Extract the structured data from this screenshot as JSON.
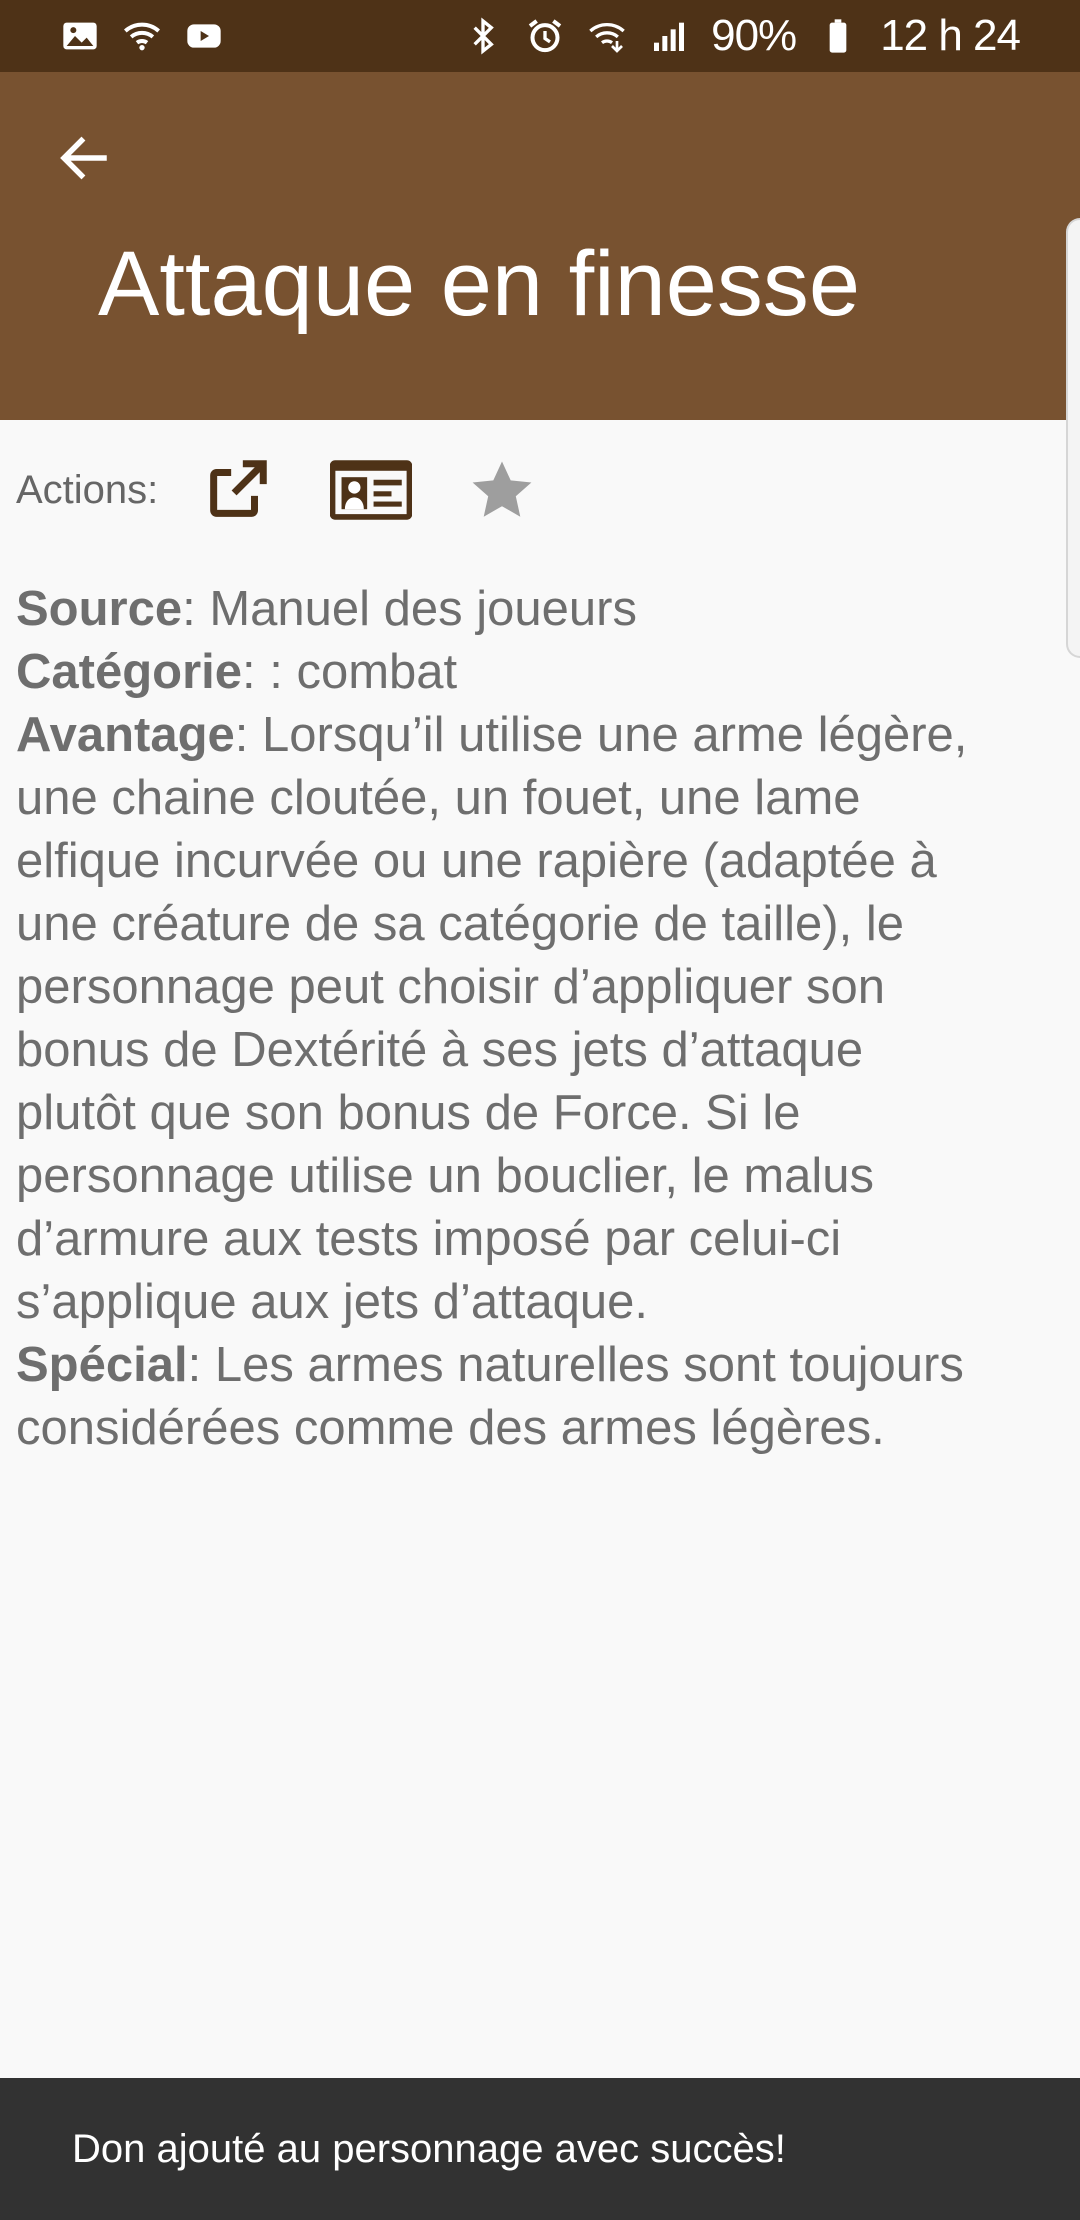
{
  "status_bar": {
    "left_icons": [
      "image-icon",
      "wifi-icon",
      "youtube-icon"
    ],
    "right_icons": [
      "bluetooth-icon",
      "alarm-icon",
      "wifi-calling-icon",
      "signal-icon"
    ],
    "battery": "90%",
    "time": "12 h 24"
  },
  "app_bar": {
    "title": "Attaque en finesse",
    "back_icon": "arrow-back-icon",
    "color": "#785230"
  },
  "actions": {
    "label": "Actions:",
    "icons": [
      "open-external-icon",
      "character-card-icon",
      "star-icon"
    ]
  },
  "feat": {
    "source_label": "Source",
    "source_value": ": Manuel des joueurs",
    "category_label": "Catégorie",
    "category_value": ": : combat",
    "benefit_label": "Avantage",
    "benefit_lines": [
      ": Lorsqu’il utilise une arme légère,",
      "une chaine cloutée, un fouet, une lame",
      "elfique incurvée ou une rapière (adaptée à",
      "une créature de sa catégorie de taille), le",
      "personnage peut choisir d’appliquer son",
      "bonus de Dextérité à ses jets d’attaque",
      "plutôt que son bonus de Force. Si le",
      "personnage utilise un bouclier, le malus",
      "d’armure aux tests imposé par celui-ci",
      "s’applique aux jets d’attaque."
    ],
    "special_label": "Spécial",
    "special_lines": [
      ": Les armes naturelles sont toujours",
      "considérées comme des armes légères."
    ]
  },
  "snackbar": {
    "message": "Don ajouté au personnage avec succès!"
  },
  "colors": {
    "status_bar": "#4e3217",
    "app_bar": "#785230",
    "icon_brown": "#4e3217",
    "star_gray": "#9e9e9e",
    "snackbar": "#323232"
  }
}
